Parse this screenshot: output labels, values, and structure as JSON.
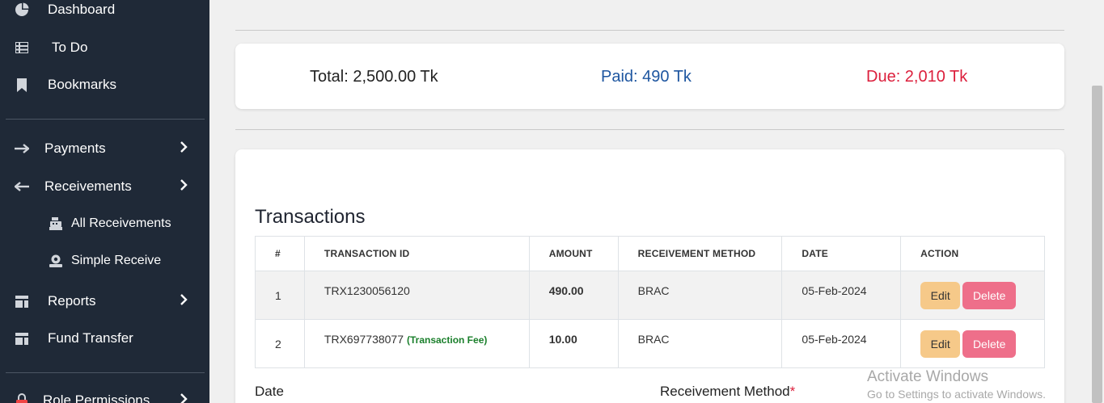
{
  "sidebar": {
    "items": [
      {
        "label": "Dashboard",
        "icon": "pie-chart-icon"
      },
      {
        "label": "To Do",
        "icon": "list-icon"
      },
      {
        "label": "Bookmarks",
        "icon": "bookmark-icon"
      },
      {
        "label": "Payments",
        "icon": "arrow-right-icon",
        "chevron": "›"
      },
      {
        "label": "Receivements",
        "icon": "arrow-left-icon",
        "chevron": "›"
      },
      {
        "label": "All Receivements",
        "icon": "cash-register-icon"
      },
      {
        "label": "Simple Receive",
        "icon": "money-hand-icon"
      },
      {
        "label": "Reports",
        "icon": "table-icon",
        "chevron": "›"
      },
      {
        "label": "Fund Transfer",
        "icon": "table-icon"
      },
      {
        "label": "Role Permissions",
        "icon": "lock-icon",
        "chevron": "›"
      }
    ]
  },
  "summary": {
    "total": "Total: 2,500.00 Tk",
    "paid": "Paid: 490 Tk",
    "due": "Due: 2,010 Tk"
  },
  "transactions": {
    "title": "Transactions",
    "headers": [
      "#",
      "TRANSACTION ID",
      "AMOUNT",
      "RECEIVEMENT METHOD",
      "DATE",
      "ACTION"
    ],
    "rows": [
      {
        "num": "1",
        "id": "TRX1230056120",
        "fee_label": "",
        "amount": "490.00",
        "method": "BRAC",
        "date": "05-Feb-2024"
      },
      {
        "num": "2",
        "id": "TRX697738077",
        "fee_label": "(Transaction Fee)",
        "amount": "10.00",
        "method": "BRAC",
        "date": "05-Feb-2024"
      }
    ],
    "edit_label": "Edit",
    "delete_label": "Delete"
  },
  "form": {
    "date_label": "Date",
    "method_label": "Receivement Method",
    "required_mark": "*"
  },
  "watermark": {
    "line1": "Activate Windows",
    "line2": "Go to Settings to activate Windows."
  },
  "colors": {
    "sidebar_bg": "#1f2937",
    "paid": "#1e56a0",
    "due": "#dc1f3c",
    "edit_button": "#f6c989",
    "delete_button": "#ee6f8a",
    "fee_text": "#1a7f2b"
  }
}
